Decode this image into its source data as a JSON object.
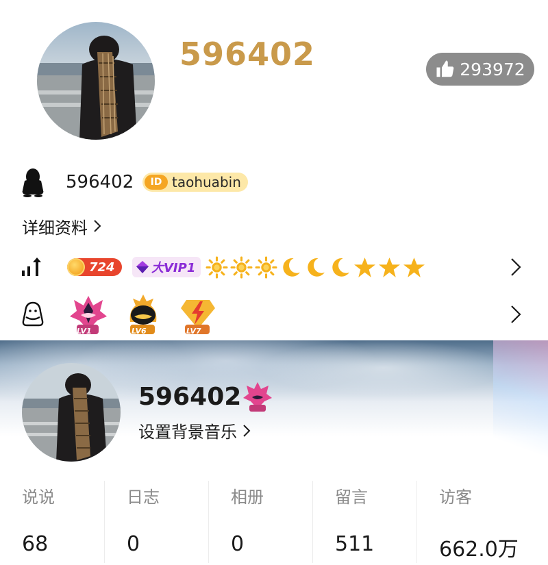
{
  "profile": {
    "nickname": "596402",
    "likes": "293972",
    "qq_number": "596402",
    "id_badge": "ID",
    "qzone_id": "taohuabin",
    "detail_link": "详细资料",
    "coin_value": "724",
    "vip_label": "大VIP1",
    "level_icons": [
      "sun-icon",
      "sun-icon",
      "sun-icon",
      "moon-icon",
      "moon-icon",
      "moon-icon",
      "star-icon",
      "star-icon",
      "star-icon"
    ],
    "badges": [
      {
        "name": "flame-badge-icon",
        "level": "LV1"
      },
      {
        "name": "penguin-badge-icon",
        "level": "LV6"
      },
      {
        "name": "lightning-badge-icon",
        "level": "LV7"
      }
    ]
  },
  "banner": {
    "nickname": "596402",
    "bg_music": "设置背景音乐"
  },
  "stats": [
    {
      "label": "说说",
      "value": "68"
    },
    {
      "label": "日志",
      "value": "0"
    },
    {
      "label": "相册",
      "value": "0"
    },
    {
      "label": "留言",
      "value": "511"
    },
    {
      "label": "访客",
      "value": "662.0万"
    }
  ],
  "colors": {
    "nickname_gold": "#c99a4b",
    "like_pill": "#8c8c8c",
    "id_chip": "#fde8a8",
    "id_badge": "#f5a623",
    "coin_chip": "#e8452d",
    "vip_text": "#8a2bd6",
    "stat_label": "#8a8a8a"
  }
}
